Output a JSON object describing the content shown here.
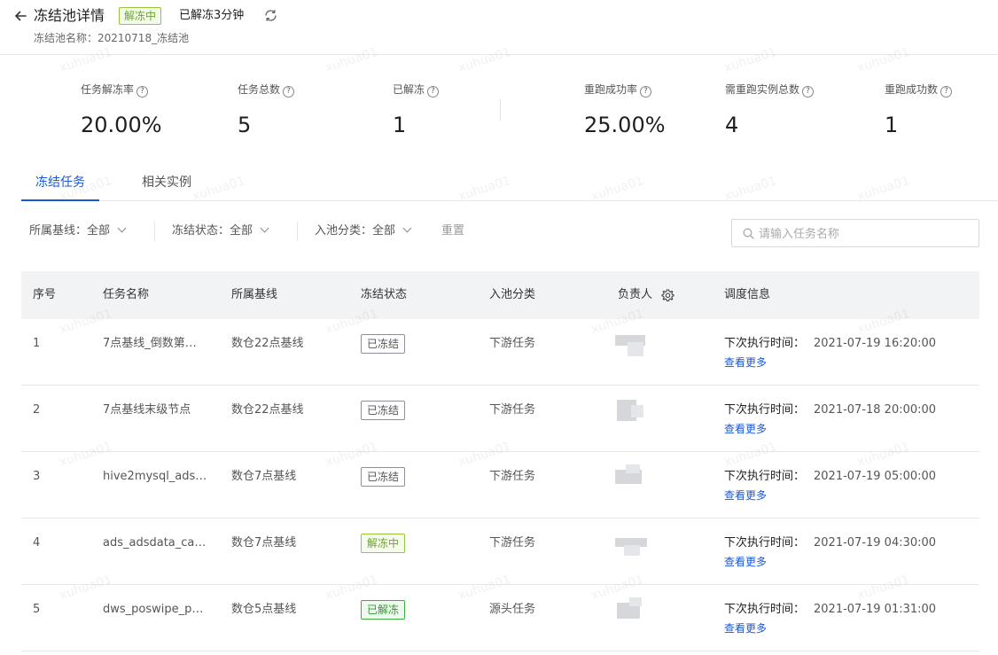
{
  "header": {
    "title": "冻结池详情",
    "status_tag": "解冻中",
    "thaw_time": "已解冻3分钟",
    "pool_name": "冻结池名称：20210718_冻结池"
  },
  "stats": [
    {
      "label": "任务解冻率",
      "value": "20.00%"
    },
    {
      "label": "任务总数",
      "value": "5"
    },
    {
      "label": "已解冻",
      "value": "1"
    },
    {
      "label": "重跑成功率",
      "value": "25.00%"
    },
    {
      "label": "需重跑实例总数",
      "value": "4"
    },
    {
      "label": "重跑成功数",
      "value": "1"
    }
  ],
  "tabs": [
    {
      "label": "冻结任务",
      "active": true
    },
    {
      "label": "相关实例",
      "active": false
    }
  ],
  "filters": {
    "baseline": "所属基线：全部",
    "freeze_status": "冻结状态：全部",
    "pool_category": "入池分类：全部",
    "reset": "重置",
    "search_placeholder": "请输入任务名称"
  },
  "table": {
    "columns": [
      "序号",
      "任务名称",
      "所属基线",
      "冻结状态",
      "入池分类",
      "负责人",
      "调度信息"
    ],
    "rows": [
      {
        "index": "1",
        "name": "7点基线_倒数第…",
        "baseline": "数仓22点基线",
        "status": "已冻结",
        "status_type": "frozen",
        "category": "下游任务",
        "next_label": "下次执行时间：",
        "next_time": "2021-07-19 16:20:00",
        "more": "查看更多"
      },
      {
        "index": "2",
        "name": "7点基线末级节点",
        "baseline": "数仓22点基线",
        "status": "已冻结",
        "status_type": "frozen",
        "category": "下游任务",
        "next_label": "下次执行时间：",
        "next_time": "2021-07-18 20:00:00",
        "more": "查看更多"
      },
      {
        "index": "3",
        "name": "hive2mysql_ads…",
        "baseline": "数仓7点基线",
        "status": "已冻结",
        "status_type": "frozen",
        "category": "下游任务",
        "next_label": "下次执行时间：",
        "next_time": "2021-07-19 05:00:00",
        "more": "查看更多"
      },
      {
        "index": "4",
        "name": "ads_adsdata_ca…",
        "baseline": "数仓7点基线",
        "status": "解冻中",
        "status_type": "thawing",
        "category": "下游任务",
        "next_label": "下次执行时间：",
        "next_time": "2021-07-19 04:30:00",
        "more": "查看更多"
      },
      {
        "index": "5",
        "name": "dws_poswipe_p…",
        "baseline": "数仓5点基线",
        "status": "已解冻",
        "status_type": "thawed",
        "category": "源头任务",
        "next_label": "下次执行时间：",
        "next_time": "2021-07-19 01:31:00",
        "more": "查看更多"
      }
    ]
  },
  "watermark": "xuhua01",
  "colors": {
    "accent": "#1a57d6",
    "thawing": "#6ba42c",
    "thawed": "#2e9b2e",
    "header_bg": "#f2f3f5"
  }
}
